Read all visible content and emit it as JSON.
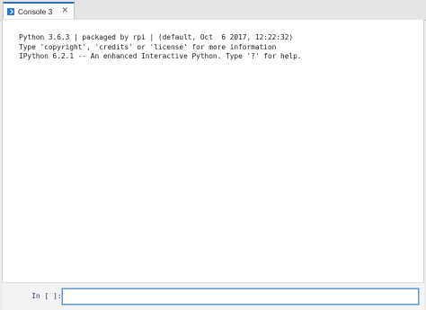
{
  "tab": {
    "label": "Console 3",
    "icon": "console-icon",
    "close_glyph": "✕"
  },
  "console": {
    "lines": [
      "Python 3.6.3 | packaged by rpi | (default, Oct  6 2017, 12:22:32)",
      "Type 'copyright', 'credits' or 'license' for more information",
      "IPython 6.2.1 -- An enhanced Interactive Python. Type '?' for help."
    ]
  },
  "input": {
    "prompt": "In [ ]:",
    "value": ""
  },
  "colors": {
    "accent": "#2f6fbf",
    "prompt": "#2a3a9a",
    "focus_border": "#5b9bd5"
  }
}
